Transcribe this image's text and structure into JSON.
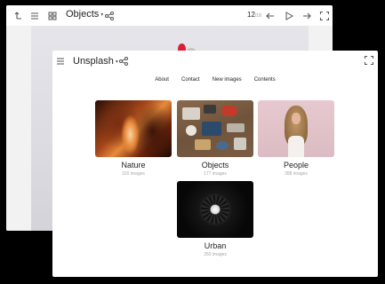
{
  "back_window": {
    "title": "Objects",
    "page_current": "12",
    "page_total": "/18"
  },
  "front_window": {
    "title": "Unsplash",
    "nav": [
      "About",
      "Contact",
      "New images",
      "Contents"
    ],
    "galleries": [
      {
        "name": "Nature",
        "count": "320 images"
      },
      {
        "name": "Objects",
        "count": "177 images"
      },
      {
        "name": "People",
        "count": "288 images"
      },
      {
        "name": "Urban",
        "count": "350 images"
      }
    ]
  },
  "icons": {
    "back_toolbar": [
      "back-arrow-icon",
      "menu-icon",
      "grid-icon",
      "share-icon",
      "prev-arrow-icon",
      "play-icon",
      "next-arrow-icon",
      "fullscreen-icon"
    ],
    "front_toolbar": [
      "menu-icon",
      "share-icon",
      "fullscreen-icon"
    ]
  },
  "colors": {
    "background": "#000000",
    "window": "#ffffff",
    "text": "#222222",
    "muted": "#a8a8a8",
    "icon": "#555555"
  }
}
